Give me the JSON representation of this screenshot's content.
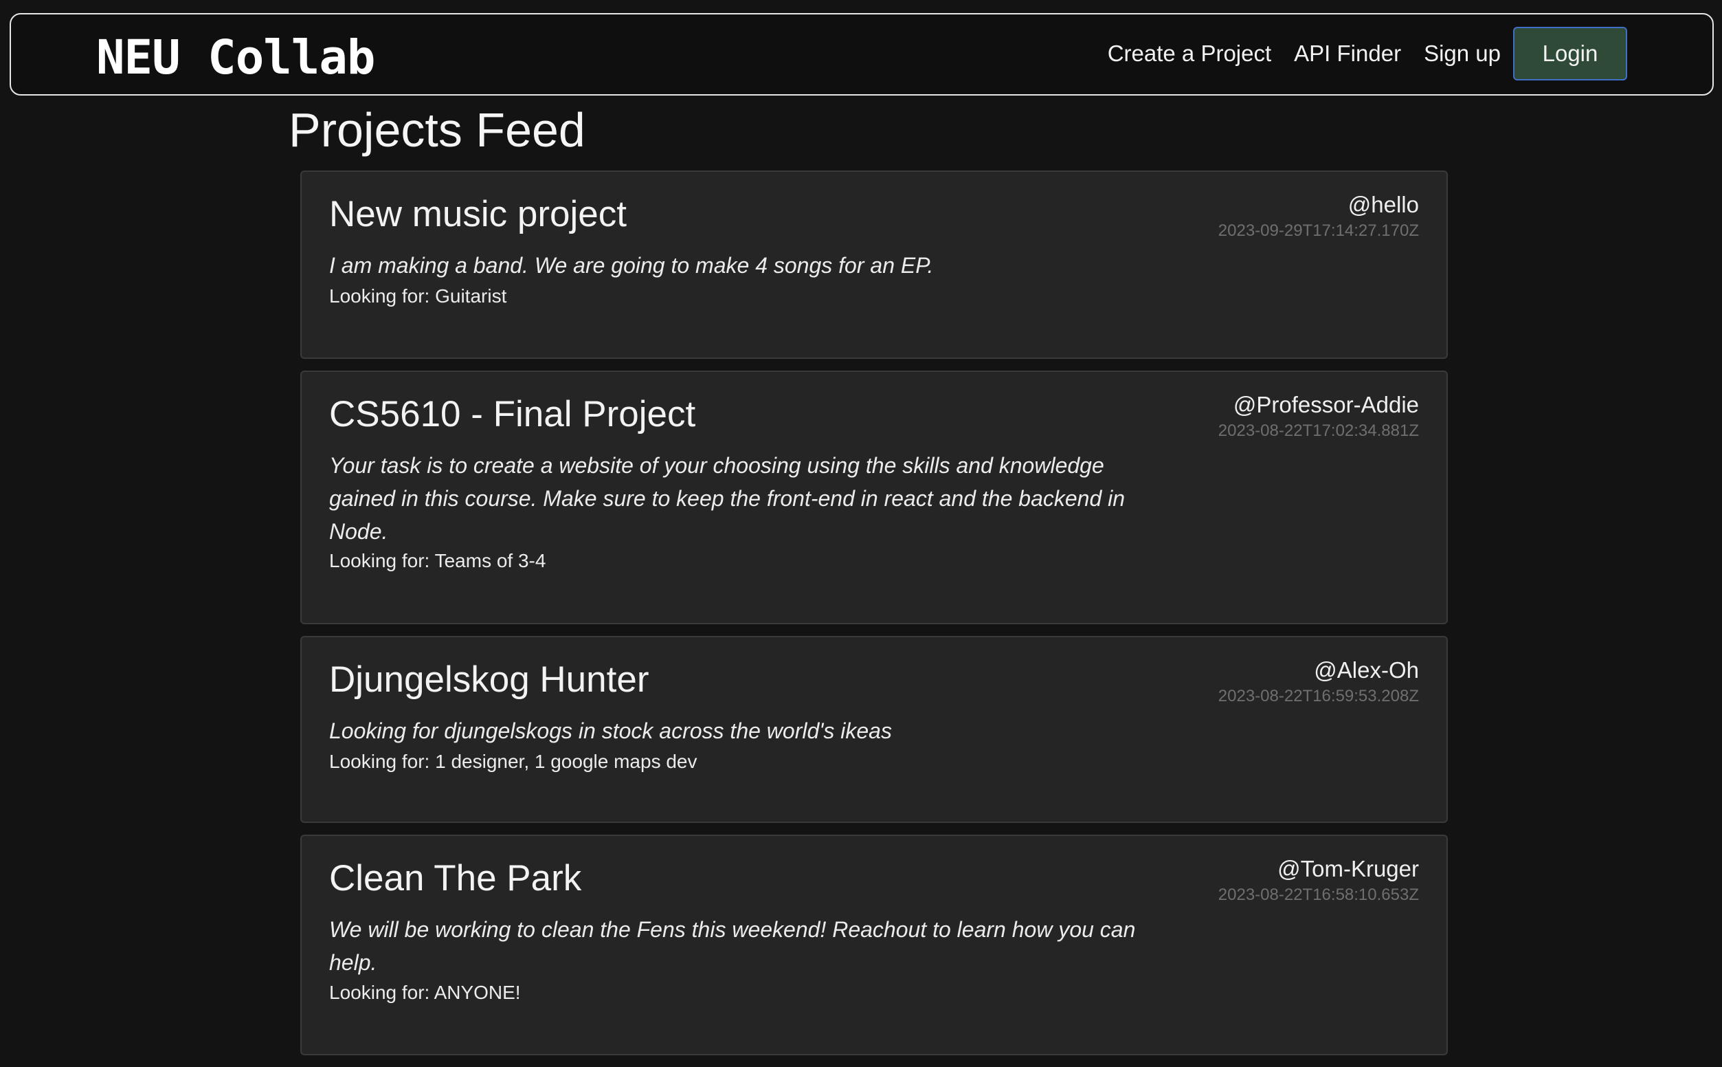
{
  "app": {
    "brand": "NEU Collab"
  },
  "nav": {
    "links": [
      {
        "label": "Create a Project"
      },
      {
        "label": "API Finder"
      },
      {
        "label": "Sign up"
      }
    ],
    "login_label": "Login"
  },
  "page": {
    "title": "Projects Feed"
  },
  "looking_prefix": "Looking for: ",
  "projects": [
    {
      "title": "New music project",
      "description": "I am making a band. We are going to make 4 songs for an EP.",
      "looking_for": "Guitarist",
      "user": "@hello",
      "timestamp": "2023-09-29T17:14:27.170Z"
    },
    {
      "title": "CS5610 - Final Project",
      "description": "Your task is to create a website of your choosing using the skills and knowledge gained in this course. Make sure to keep the front-end in react and the backend in Node.",
      "looking_for": "Teams of 3-4",
      "user": "@Professor-Addie",
      "timestamp": "2023-08-22T17:02:34.881Z"
    },
    {
      "title": "Djungelskog Hunter",
      "description": "Looking for djungelskogs in stock across the world's ikeas",
      "looking_for": "1 designer, 1 google maps dev",
      "user": "@Alex-Oh",
      "timestamp": "2023-08-22T16:59:53.208Z"
    },
    {
      "title": "Clean The Park",
      "description": "We will be working to clean the Fens this weekend! Reachout to learn how you can help.",
      "looking_for": "ANYONE!",
      "user": "@Tom-Kruger",
      "timestamp": "2023-08-22T16:58:10.653Z"
    }
  ]
}
